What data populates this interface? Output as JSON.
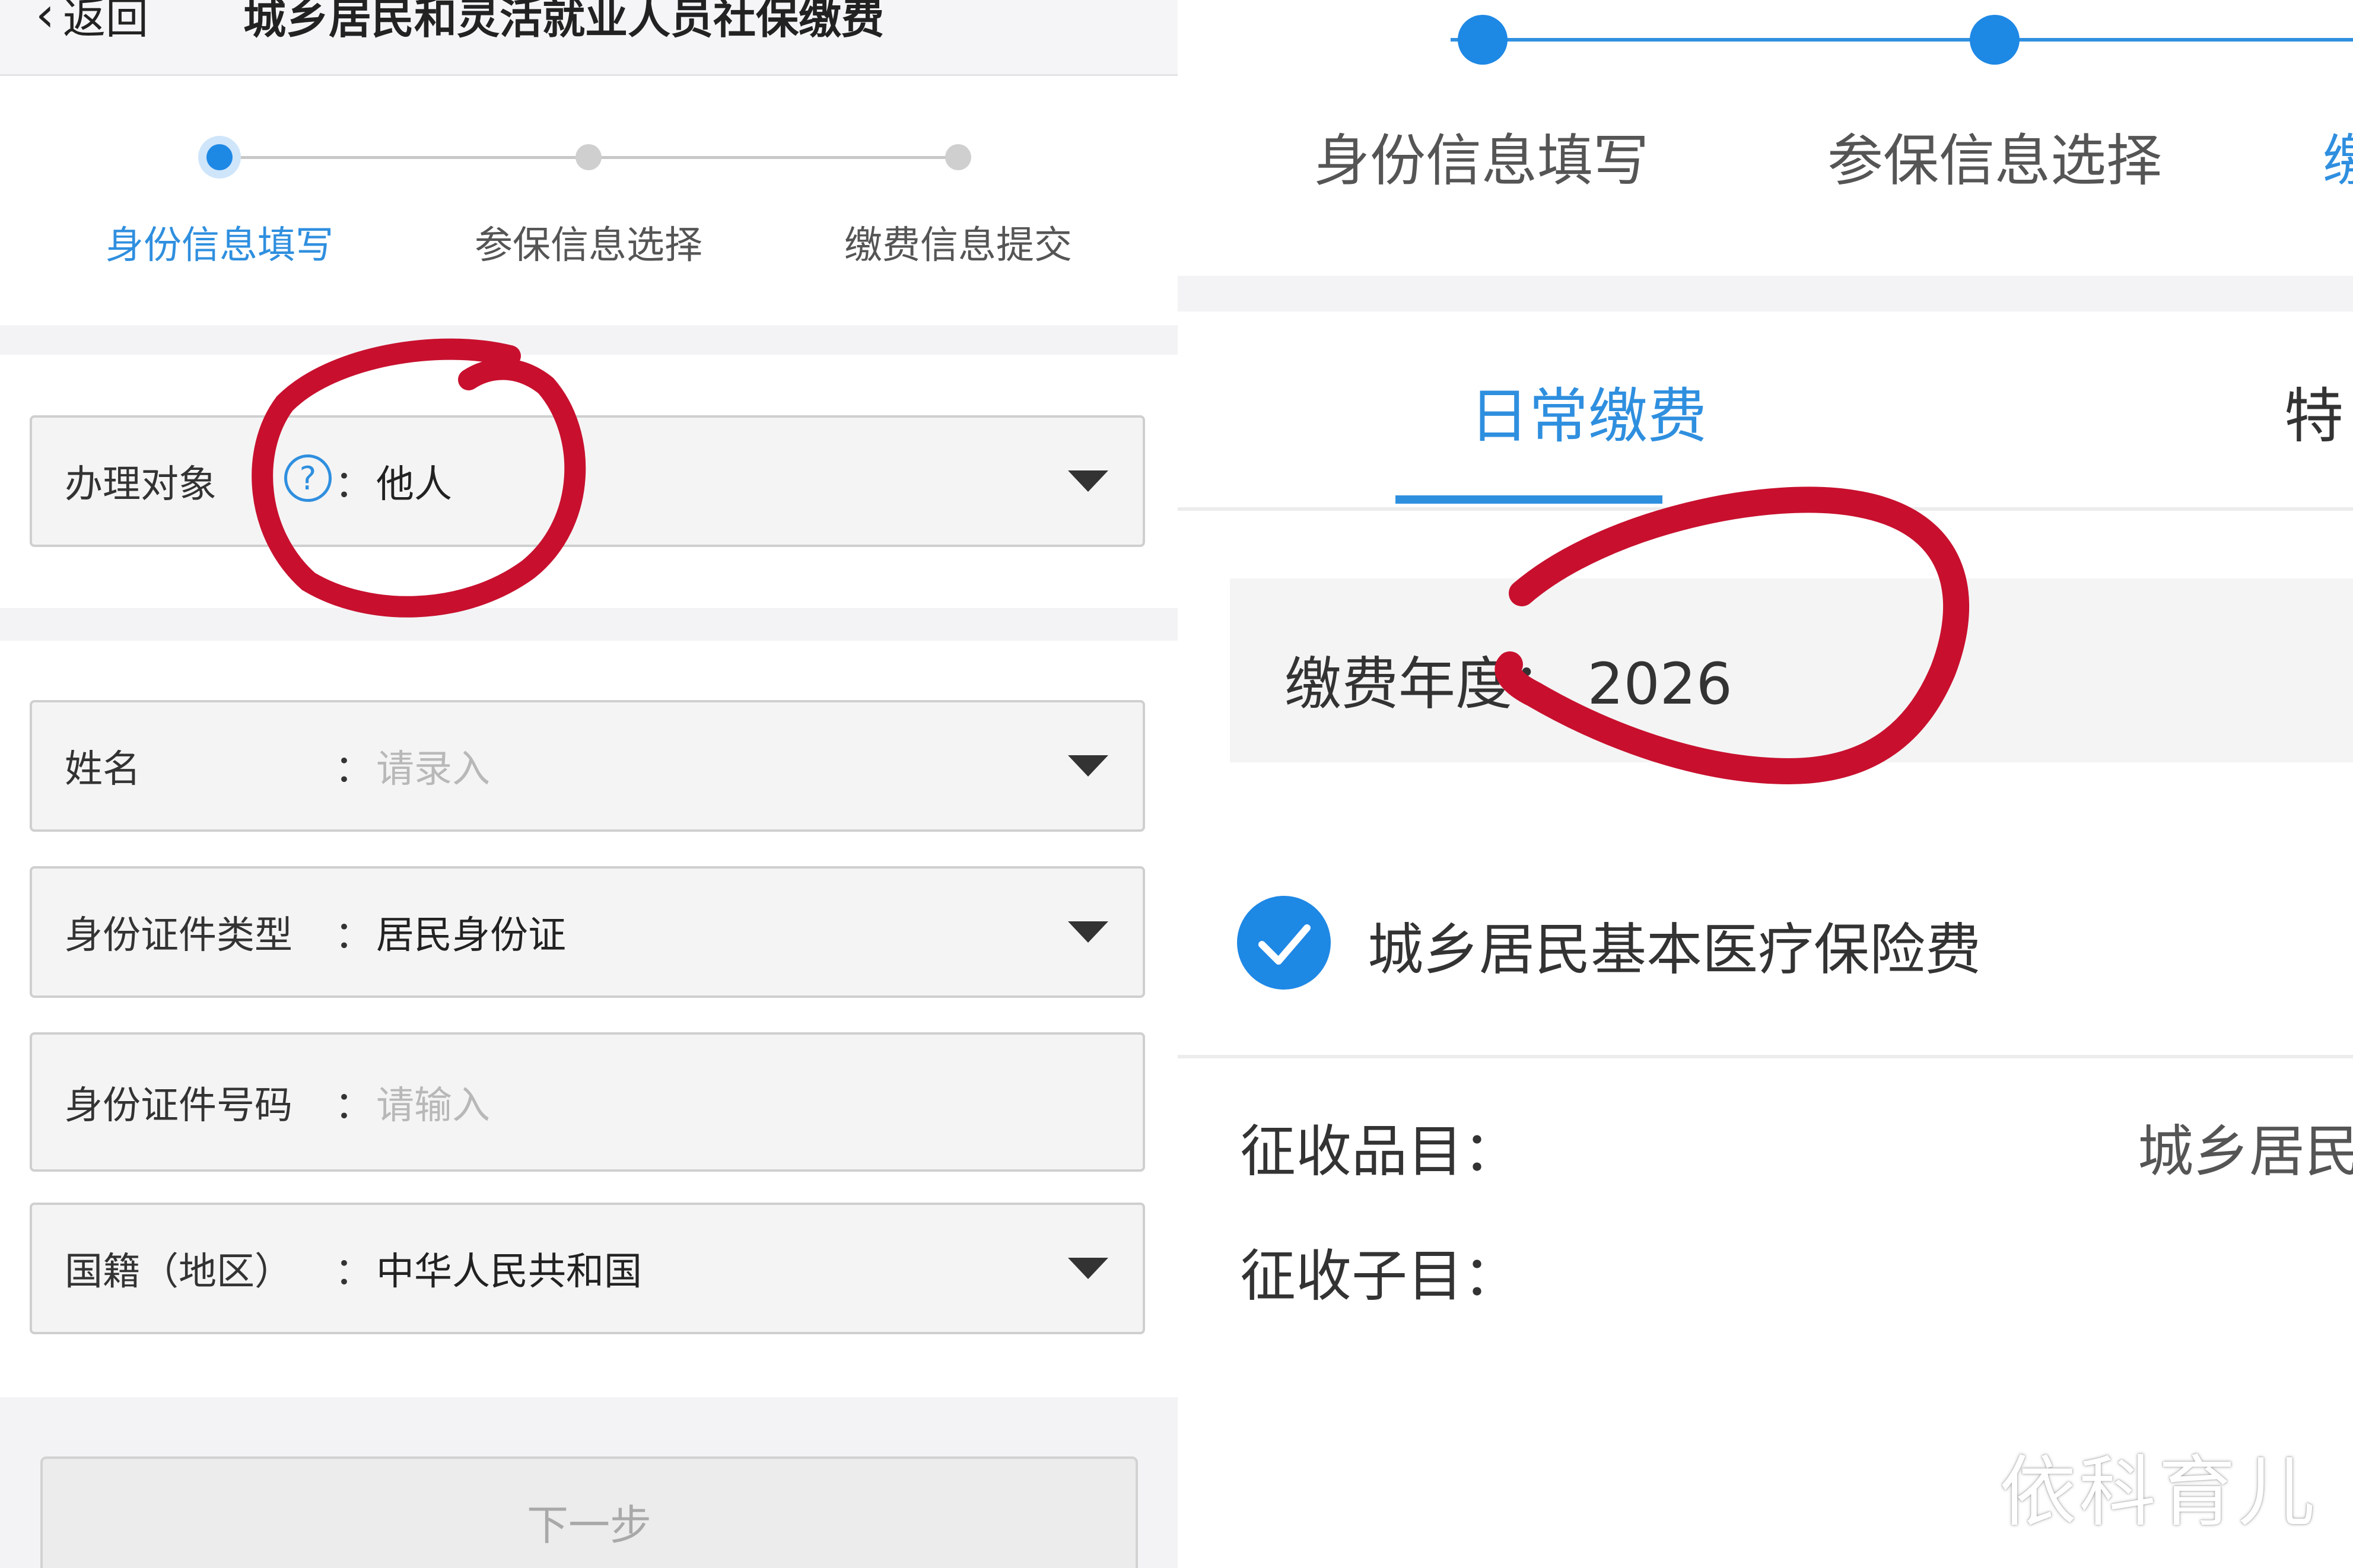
{
  "left": {
    "nav": {
      "back_label": "返回",
      "title": "城乡居民和灵活就业人员社保缴费"
    },
    "steps": [
      {
        "label": "身份信息填写",
        "active": true
      },
      {
        "label": "参保信息选择",
        "active": false
      },
      {
        "label": "缴费信息提交",
        "active": false
      }
    ],
    "fields": {
      "target": {
        "label": "办理对象",
        "colon": "：",
        "value": "他人",
        "help": "?"
      },
      "name": {
        "label": "姓名",
        "colon": "：",
        "placeholder": "请录入"
      },
      "id_type": {
        "label": "身份证件类型",
        "colon": "：",
        "value": "居民身份证"
      },
      "id_number": {
        "label": "身份证件号码",
        "colon": "：",
        "placeholder": "请输入"
      },
      "nationality": {
        "label": "国籍（地区）",
        "colon": "：",
        "value": "中华人民共和国"
      }
    },
    "next_button": "下一步"
  },
  "right": {
    "steps": [
      {
        "label": "身份信息填写"
      },
      {
        "label": "参保信息选择"
      },
      {
        "label": "缴"
      }
    ],
    "tabs": {
      "active": "日常缴费",
      "other": "特"
    },
    "year": {
      "label": "缴费年度：",
      "value": "2026"
    },
    "insurance_item": "城乡居民基本医疗保险费",
    "levy_item": {
      "label": "征收品目：",
      "value": "城乡居民"
    },
    "levy_subitem": {
      "label": "征收子目："
    },
    "watermark": "依科育儿"
  },
  "colors": {
    "accent": "#1e88e5",
    "annotation": "#c8102e"
  }
}
